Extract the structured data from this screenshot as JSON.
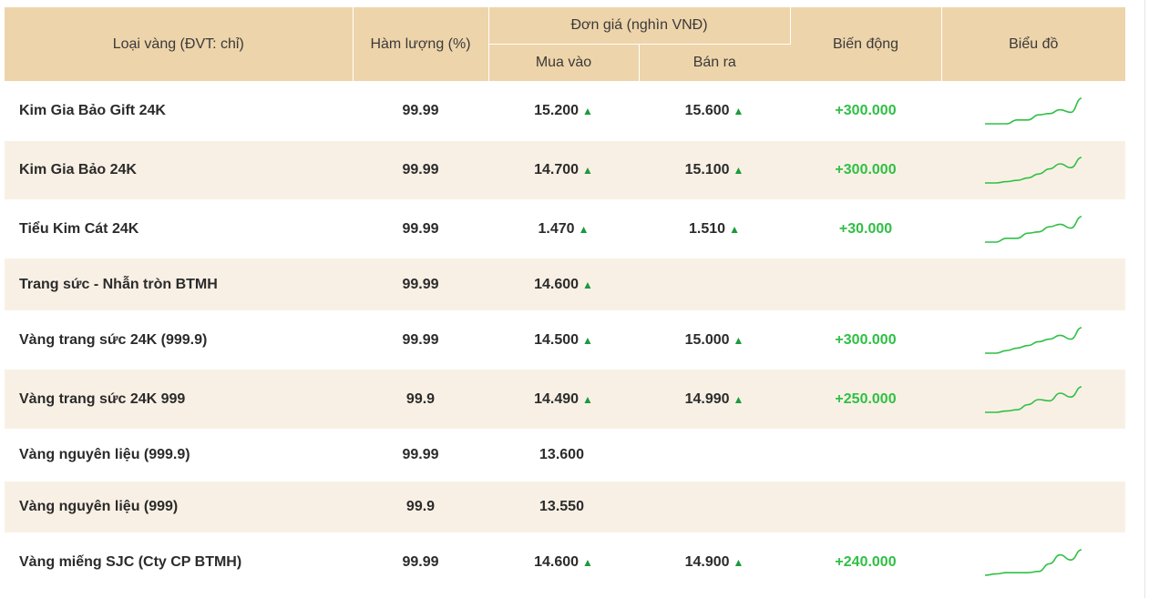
{
  "header": {
    "type": "Loại vàng (ĐVT: chỉ)",
    "purity": "Hàm lượng (%)",
    "unit_price": "Đơn giá (nghìn VNĐ)",
    "buy": "Mua vào",
    "sell": "Bán ra",
    "change": "Biến động",
    "chart": "Biểu đồ"
  },
  "up_arrow": "▲",
  "colors": {
    "header_bg": "#eed4aa",
    "stripe_bg": "#f9f0e5",
    "up": "#1a9b3c",
    "change": "#2fc045",
    "sparkline": "#2fc045"
  },
  "rows": [
    {
      "name": "Kim Gia Bảo Gift 24K",
      "purity": "99.99",
      "buy": "15.200",
      "buy_up": true,
      "sell": "15.600",
      "sell_up": true,
      "change": "+300.000",
      "spark": [
        0,
        0,
        0,
        0.15,
        0.15,
        0.35,
        0.4,
        0.55,
        0.45,
        1.0
      ]
    },
    {
      "name": "Kim Gia Bảo 24K",
      "purity": "99.99",
      "buy": "14.700",
      "buy_up": true,
      "sell": "15.100",
      "sell_up": true,
      "change": "+300.000",
      "spark": [
        0,
        0,
        0.05,
        0.1,
        0.2,
        0.35,
        0.55,
        0.75,
        0.6,
        1.0
      ]
    },
    {
      "name": "Tiểu Kim Cát 24K",
      "purity": "99.99",
      "buy": "1.470",
      "buy_up": true,
      "sell": "1.510",
      "sell_up": true,
      "change": "+30.000",
      "spark": [
        0,
        0,
        0.15,
        0.15,
        0.35,
        0.4,
        0.6,
        0.7,
        0.55,
        1.0
      ]
    },
    {
      "name": "Trang sức - Nhẫn tròn BTMH",
      "purity": "99.99",
      "buy": "14.600",
      "buy_up": true,
      "sell": "",
      "sell_up": false,
      "change": "",
      "spark": []
    },
    {
      "name": "Vàng trang sức 24K (999.9)",
      "purity": "99.99",
      "buy": "14.500",
      "buy_up": true,
      "sell": "15.000",
      "sell_up": true,
      "change": "+300.000",
      "spark": [
        0,
        0,
        0.1,
        0.2,
        0.3,
        0.45,
        0.55,
        0.7,
        0.55,
        1.0
      ]
    },
    {
      "name": "Vàng trang sức 24K 999",
      "purity": "99.9",
      "buy": "14.490",
      "buy_up": true,
      "sell": "14.990",
      "sell_up": true,
      "change": "+250.000",
      "spark": [
        0,
        0,
        0.05,
        0.1,
        0.3,
        0.5,
        0.45,
        0.75,
        0.6,
        1.0
      ]
    },
    {
      "name": "Vàng nguyên liệu (999.9)",
      "purity": "99.99",
      "buy": "13.600",
      "buy_up": false,
      "sell": "",
      "sell_up": false,
      "change": "",
      "spark": []
    },
    {
      "name": "Vàng nguyên liệu (999)",
      "purity": "99.9",
      "buy": "13.550",
      "buy_up": false,
      "sell": "",
      "sell_up": false,
      "change": "",
      "spark": []
    },
    {
      "name": "Vàng miếng SJC (Cty CP BTMH)",
      "purity": "99.99",
      "buy": "14.600",
      "buy_up": true,
      "sell": "14.900",
      "sell_up": true,
      "change": "+240.000",
      "spark": [
        0,
        0.05,
        0.1,
        0.1,
        0.1,
        0.15,
        0.45,
        0.8,
        0.6,
        1.0
      ]
    }
  ]
}
